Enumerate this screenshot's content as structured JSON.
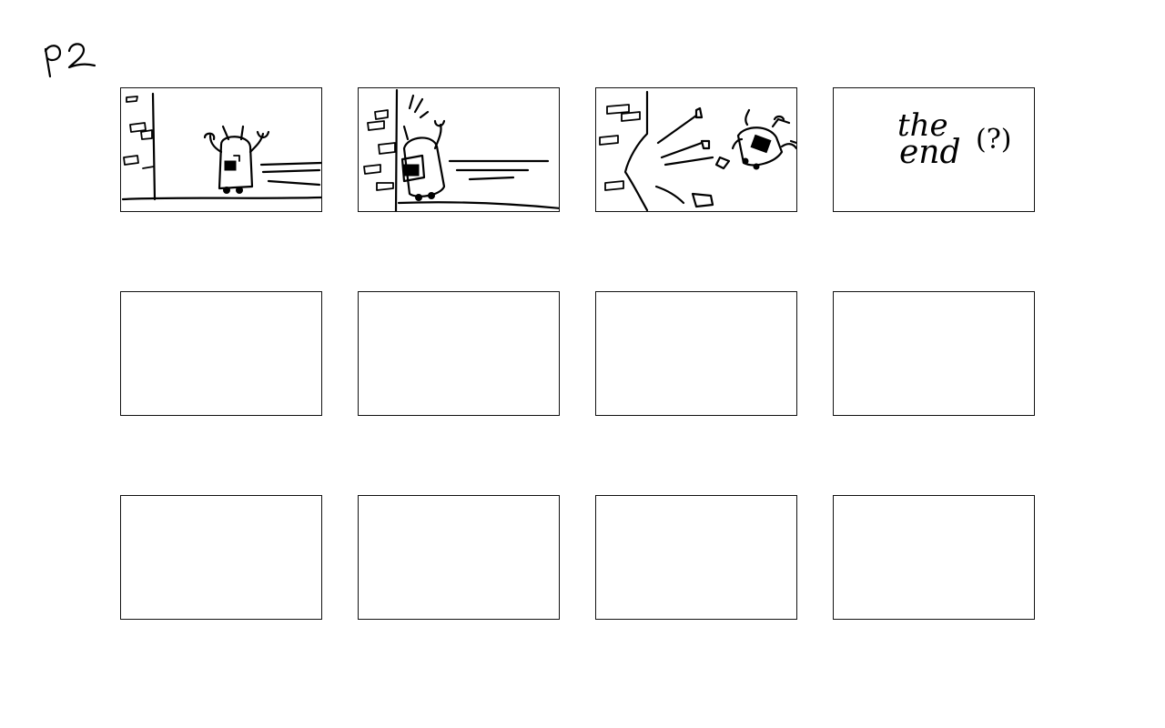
{
  "page": {
    "label": "p2"
  },
  "panels": {
    "p4": {
      "text_line1": "the",
      "text_line2": "end",
      "text_aside": "(?)"
    }
  }
}
